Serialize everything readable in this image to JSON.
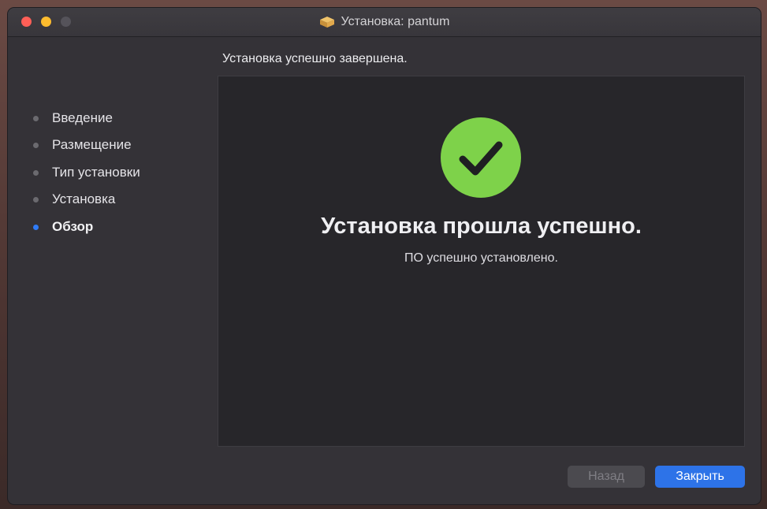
{
  "window": {
    "title": "Установка: pantum",
    "title_icon": "package-icon"
  },
  "sidebar": {
    "steps": [
      {
        "label": "Введение",
        "active": false
      },
      {
        "label": "Размещение",
        "active": false
      },
      {
        "label": "Тип установки",
        "active": false
      },
      {
        "label": "Установка",
        "active": false
      },
      {
        "label": "Обзор",
        "active": true
      }
    ]
  },
  "main": {
    "heading": "Установка успешно завершена.",
    "success_title": "Установка прошла успешно.",
    "success_subtitle": "ПО успешно установлено.",
    "success_icon": "checkmark-icon"
  },
  "buttons": {
    "back_label": "Назад",
    "close_label": "Закрыть"
  },
  "colors": {
    "accent": "#2d73e8",
    "success": "#7ed24a",
    "active_step_dot": "#2f7bf6"
  }
}
